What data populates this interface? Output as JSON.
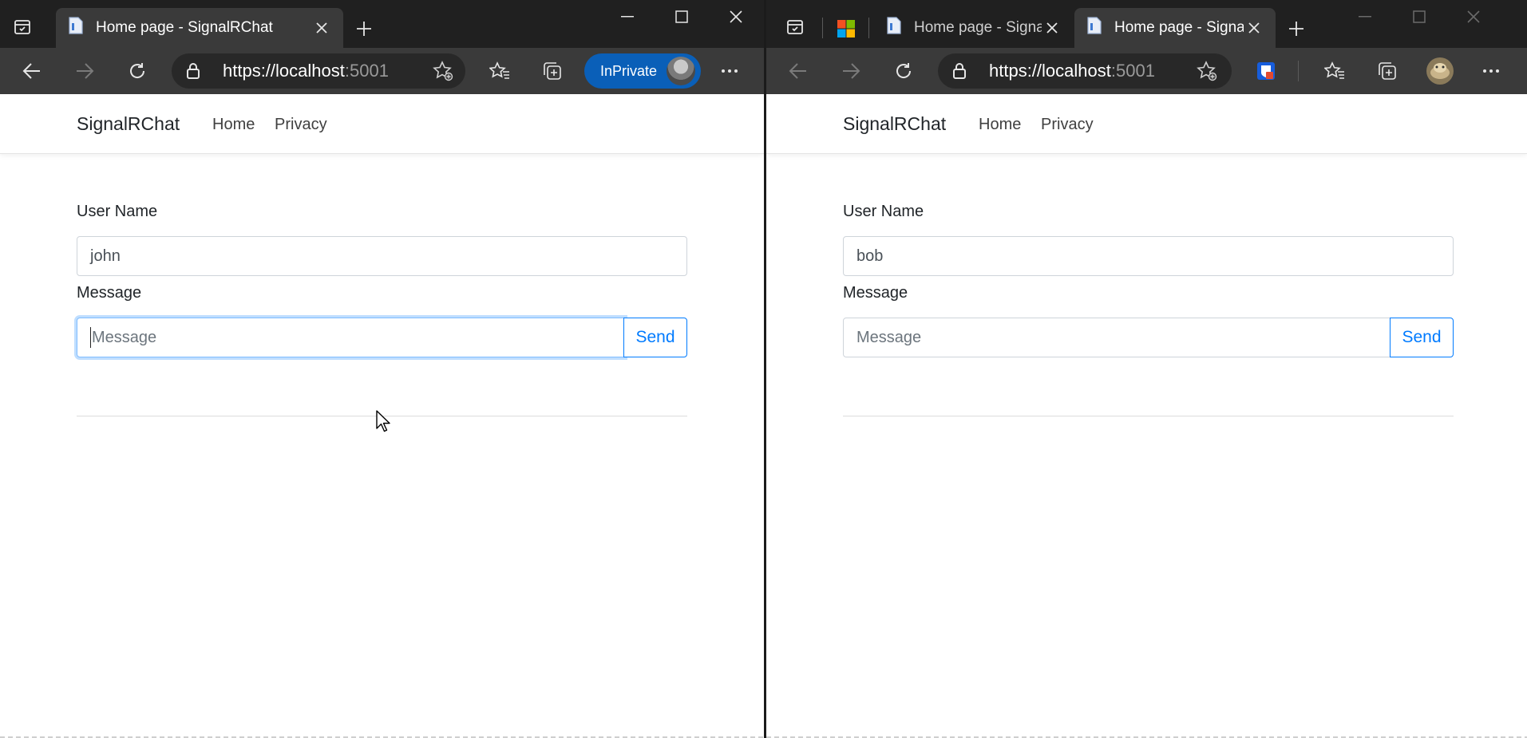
{
  "colors": {
    "tab_strip": "#202020",
    "toolbar": "#3a3a3a",
    "accent_blue": "#007bff",
    "inprivate": "#0a5fb8"
  },
  "left_window": {
    "tab_title": "Home page - SignalRChat",
    "url_host": "https://localhost",
    "url_port": ":5001",
    "inprivate_label": "InPrivate",
    "page": {
      "brand": "SignalRChat",
      "nav_home": "Home",
      "nav_privacy": "Privacy",
      "user_name_label": "User Name",
      "user_name_value": "john",
      "message_label": "Message",
      "message_placeholder": "Message",
      "send_label": "Send"
    }
  },
  "right_window": {
    "tab1_title": "Home page - Signal",
    "tab2_title": "Home page - Signa",
    "url_host": "https://localhost",
    "url_port": ":5001",
    "page": {
      "brand": "SignalRChat",
      "nav_home": "Home",
      "nav_privacy": "Privacy",
      "user_name_label": "User Name",
      "user_name_value": "bob",
      "message_label": "Message",
      "message_placeholder": "Message",
      "send_label": "Send"
    }
  }
}
